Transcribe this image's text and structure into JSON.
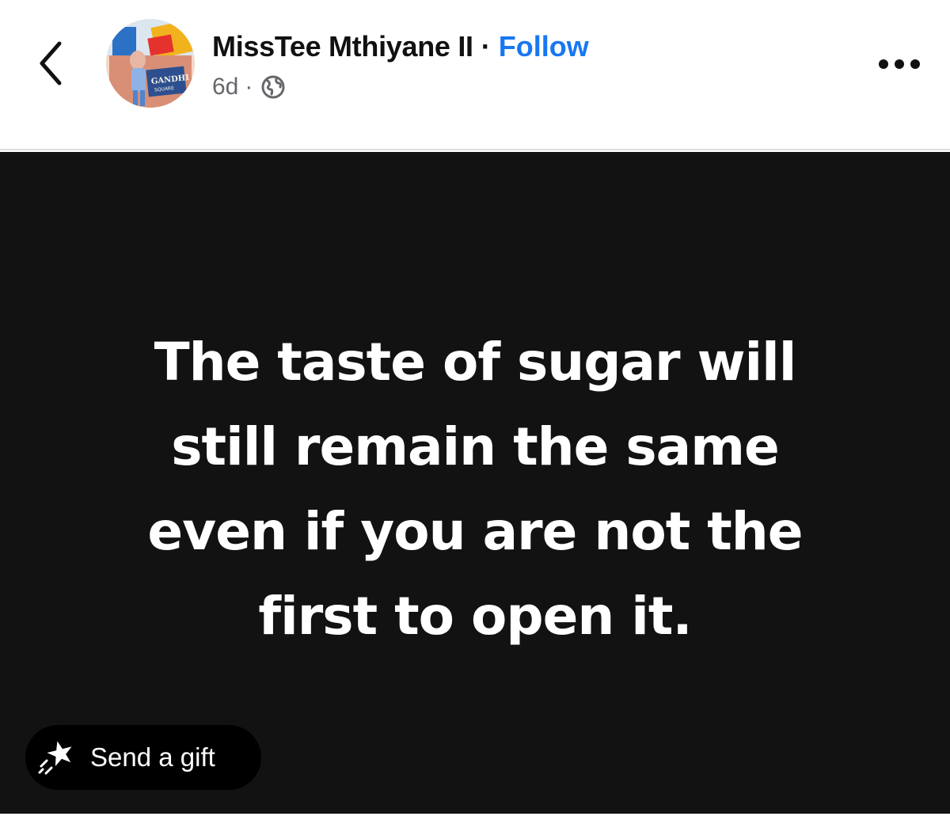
{
  "post": {
    "author_name": "MissTee Mthiyane II",
    "separator": "·",
    "follow_label": "Follow",
    "timestamp": "6d",
    "meta_separator": "·",
    "privacy_icon": "globe-icon"
  },
  "navigation": {
    "back_icon": "chevron-left-icon",
    "more_icon": "more-horizontal-icon"
  },
  "avatar": {
    "sign_text_line1": "GANDHI",
    "sign_text_line2": "SQUARE"
  },
  "image": {
    "quote_lines": [
      "The taste of sugar will",
      "still remain the same",
      "even if you are not the",
      "first to open it."
    ]
  },
  "gift": {
    "label": "Send a gift",
    "icon": "sparkle-gift-icon"
  },
  "colors": {
    "follow": "#1877f2",
    "image_background": "#121212",
    "meta_text": "#65676b"
  }
}
